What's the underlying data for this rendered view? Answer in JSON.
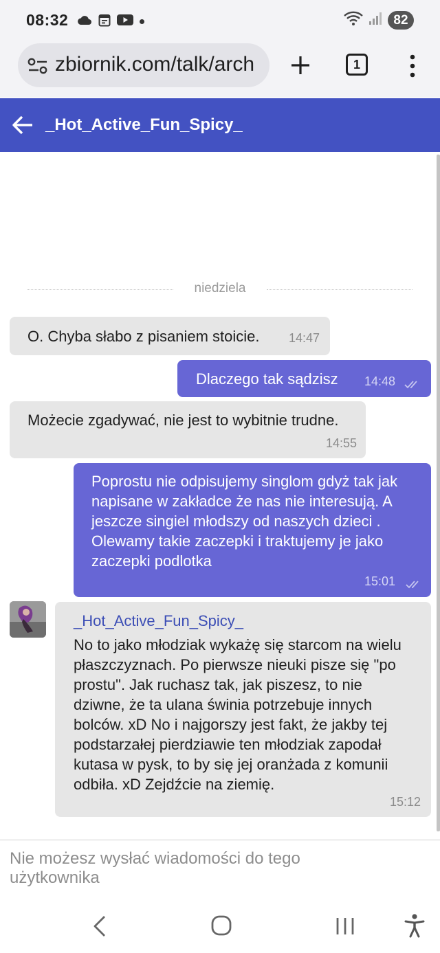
{
  "status_bar": {
    "time": "08:32",
    "battery": "82",
    "left_icons": [
      "cloud-icon",
      "calendar-icon",
      "youtube-icon",
      "notification-dot-icon"
    ],
    "right_icons": [
      "wifi-icon",
      "signal-icon",
      "battery-icon"
    ]
  },
  "browser": {
    "url": "zbiornik.com/talk/arch",
    "tab_count": "1",
    "icons": [
      "site-settings-icon",
      "new-tab-icon",
      "tab-switcher-icon",
      "more-menu-icon"
    ]
  },
  "header": {
    "title": "_Hot_Active_Fun_Spicy_",
    "back_icon": "back-arrow-icon",
    "color": "#4352c2"
  },
  "chat": {
    "day_separator": "niedziela",
    "messages": [
      {
        "direction": "incoming",
        "text": "O. Chyba słabo z pisaniem stoicie.",
        "time": "14:47"
      },
      {
        "direction": "outgoing",
        "text": "Dlaczego tak sądzisz",
        "time": "14:48",
        "status": "read"
      },
      {
        "direction": "incoming",
        "text": "Możecie zgadywać, nie jest to wybitnie trudne.",
        "time": "14:55"
      },
      {
        "direction": "outgoing",
        "text": "Poprostu nie odpisujemy singlom gdyż tak jak napisane w zakładce że nas nie interesują. A jeszcze singiel młodszy od naszych dzieci . Olewamy takie zaczepki i traktujemy je jako zaczepki podlotka",
        "time": "15:01",
        "status": "read"
      },
      {
        "direction": "incoming",
        "sender": "_Hot_Active_Fun_Spicy_",
        "text": "No to jako młodziak wykażę się starcom na wielu płaszczyznach. Po pierwsze nieuki pisze się \"po prostu\". Jak ruchasz tak, jak piszesz, to nie dziwne, że ta ulana świnia potrzebuje innych bolców. xD No i najgorszy jest fakt, że jakby tej podstarzałej pierdziawie ten młodziak zapodał kutasa w pysk, to by się jej oranżada z komunii odbiła. xD Zejdźcie na ziemię.",
        "time": "15:12"
      }
    ],
    "colors": {
      "incoming_bubble": "#e6e6e6",
      "outgoing_bubble": "#6766d5"
    }
  },
  "composer": {
    "disabled_text": "Nie możesz wysłać wiadomości do tego użytkownika"
  },
  "navbar": {
    "icons": [
      "nav-back-icon",
      "nav-home-icon",
      "nav-recents-icon",
      "accessibility-icon"
    ]
  }
}
